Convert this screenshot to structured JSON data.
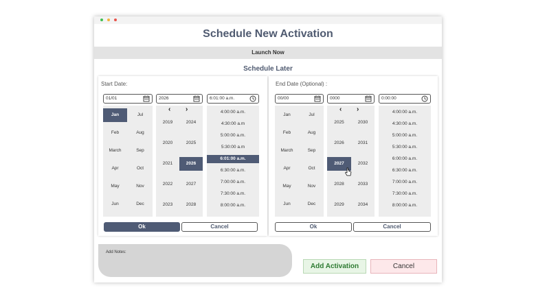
{
  "title": "Schedule New Activation",
  "launch_now": "Launch Now",
  "schedule_later": "Schedule Later",
  "start": {
    "label": "Start Date:",
    "date_value": "01/01",
    "year_value": "2026",
    "time_value": "6:01:00 a.m.",
    "months_left": [
      "Jan",
      "Feb",
      "March",
      "Apr",
      "May",
      "Jun"
    ],
    "months_right": [
      "Jul",
      "Aug",
      "Sep",
      "Oct",
      "Nov",
      "Dec"
    ],
    "selected_month": "Jan",
    "years_left": [
      "2019",
      "2020",
      "2021",
      "2022",
      "2023"
    ],
    "years_right": [
      "2024",
      "2025",
      "2026",
      "2027",
      "2028"
    ],
    "selected_year": "2026",
    "times": [
      "4:00:00 a.m.",
      "4:30:00 a.m",
      "5:00:00 a.m.",
      "5:30:00 a.m",
      "6:01:00 a.m.",
      "6:30:00 a.m.",
      "7:00:00 a.m.",
      "7:30:00 a.m.",
      "8:00:00 a.m."
    ],
    "selected_time": "6:01:00 a.m.",
    "ok": "Ok",
    "cancel": "Cancel"
  },
  "end": {
    "label": "End Date (Optional) :",
    "date_value": "00/00",
    "year_value": "0000",
    "time_value": "0:00:00",
    "months_left": [
      "Jan",
      "Feb",
      "March",
      "Apr",
      "May",
      "Jun"
    ],
    "months_right": [
      "Jul",
      "Aug",
      "Sep",
      "Oct",
      "Nov",
      "Dec"
    ],
    "years_left": [
      "2025",
      "2026",
      "2027",
      "2028",
      "2029"
    ],
    "years_right": [
      "2030",
      "2031",
      "2032",
      "2033",
      "2034"
    ],
    "selected_year": "2027",
    "times": [
      "4:00:00 a.m.",
      "4:30:00 a.m.",
      "5:00:00 a.m.",
      "5:30:00 a.m.",
      "6:00:00 a.m.",
      "6:30:00 a.m.",
      "7:00:00 a.m.",
      "7:30:00 a.m.",
      "8:00:00 a.m."
    ],
    "ok": "Ok",
    "cancel": "Cancel"
  },
  "notes_label": "Add Notes:",
  "add_activation": "Add Activation",
  "cancel_main": "Cancel",
  "colors": {
    "accent": "#4f5b75",
    "success_bg": "#e8f5e6",
    "danger_bg": "#fde8ea"
  },
  "icons": {
    "calendar": "calendar-icon",
    "clock": "clock-icon",
    "prev": "chevron-left-icon",
    "next": "chevron-right-icon"
  }
}
